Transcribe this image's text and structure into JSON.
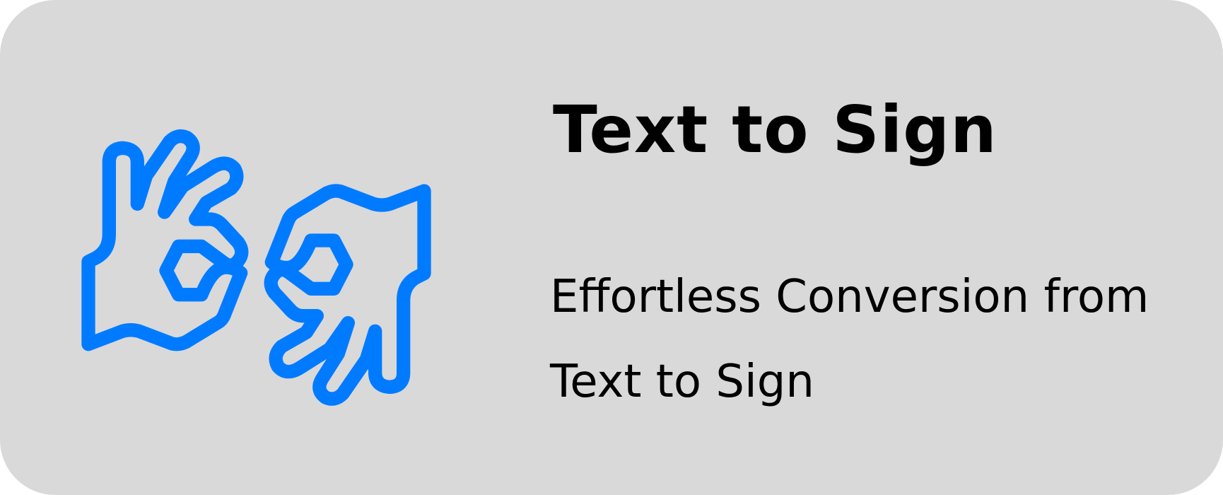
{
  "card": {
    "title": "Text to Sign",
    "subtitle": "Effortless Conversion from Text to Sign",
    "icon": "sign-language-hands-icon",
    "accent_color": "#007bff",
    "background_color": "#d9d9d9"
  }
}
